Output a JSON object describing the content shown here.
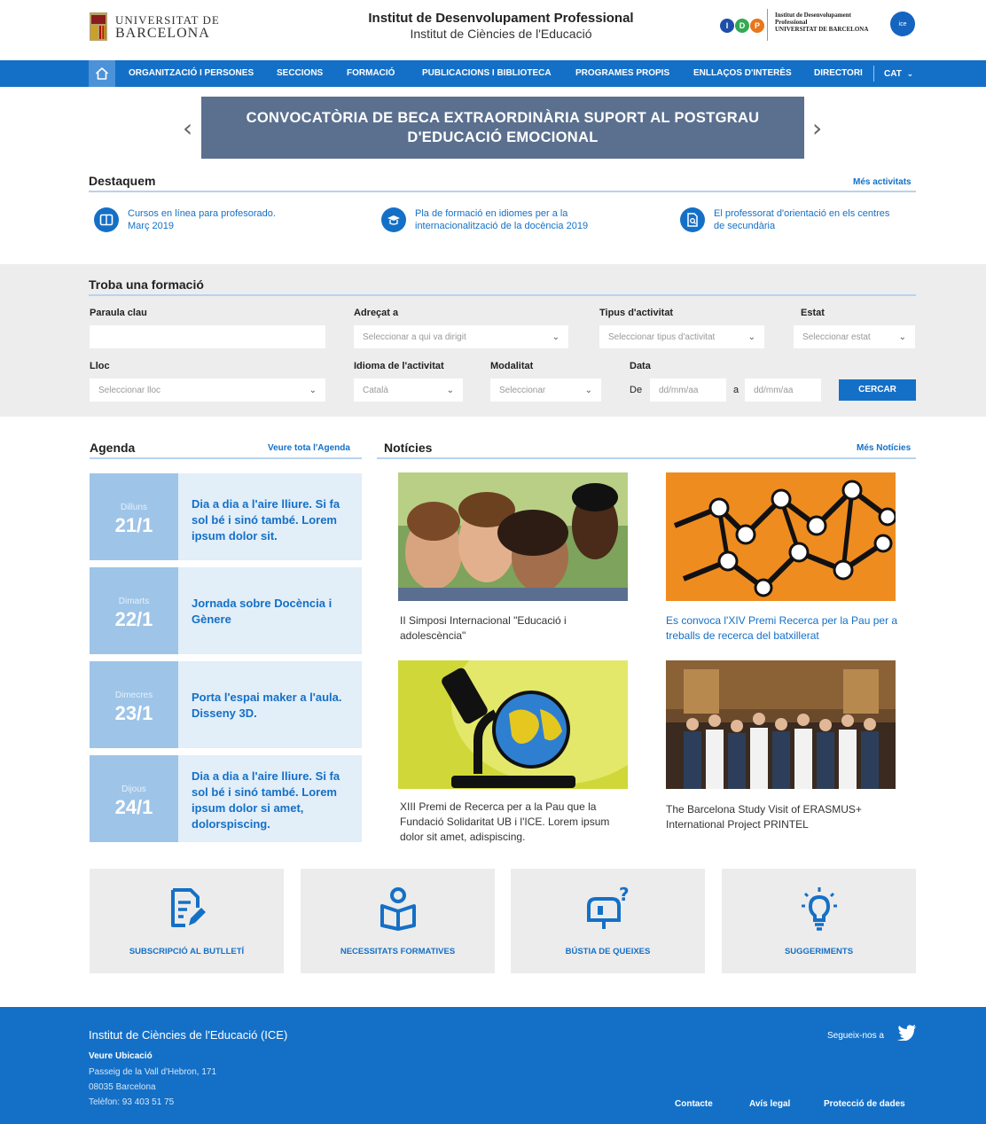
{
  "header": {
    "ub_line1": "UNIVERSITAT DE",
    "ub_line2": "BARCELONA",
    "title": "Institut de Desenvolupament Professional",
    "subtitle": "Institut de Ciències de l'Educació",
    "idp_text_1": "Institut de Desenvolupament",
    "idp_text_2": "Professional",
    "idp_text_3": "UNIVERSITAT DE BARCELONA",
    "ice_badge": "ice"
  },
  "nav": {
    "items": [
      "ORGANITZACIÓ I PERSONES",
      "SECCIONS",
      "FORMACIÓ",
      "PUBLICACIONS I BIBLIOTECA",
      "PROGRAMES PROPIS",
      "ENLLAÇOS D'INTERÈS",
      "DIRECTORI"
    ],
    "lang": "CAT"
  },
  "banner": {
    "line1": "CONVOCATÒRIA DE BECA EXTRAORDINÀRIA SUPORT AL POSTGRAU",
    "line2": "D'EDUCACIÓ EMOCIONAL"
  },
  "destaquem": {
    "title": "Destaquem",
    "more": "Més activitats",
    "items": [
      {
        "l1": "Cursos en línea para profesorado.",
        "l2": "Març 2019"
      },
      {
        "l1": "Pla de formació en idiomes per a la",
        "l2": "internacionalització de la docència 2019"
      },
      {
        "l1": "El professorat d'orientació en els centres",
        "l2": "de secundària"
      }
    ]
  },
  "search": {
    "title": "Troba una formació",
    "keyword_label": "Paraula clau",
    "adrecat_label": "Adreçat a",
    "adrecat_ph": "Seleccionar a qui va dirigit",
    "tipus_label": "Tipus d'activitat",
    "tipus_ph": "Seleccionar tipus d'activitat",
    "estat_label": "Estat",
    "estat_ph": "Seleccionar estat",
    "lloc_label": "Lloc",
    "lloc_ph": "Seleccionar lloc",
    "idioma_label": "Idioma de l'activitat",
    "idioma_value": "Català",
    "modalitat_label": "Modalitat",
    "modalitat_ph": "Seleccionar",
    "data_label": "Data",
    "de": "De",
    "date_from_ph": "dd/mm/aa",
    "a": "a",
    "date_to_ph": "dd/mm/aa",
    "button": "CERCAR"
  },
  "agenda": {
    "title": "Agenda",
    "more": "Veure tota l'Agenda",
    "items": [
      {
        "day": "Dilluns",
        "date": "21/1",
        "title": "Dia a dia a l'aire lliure. Si fa sol bé i sinó també. Lorem ipsum dolor sit."
      },
      {
        "day": "Dimarts",
        "date": "22/1",
        "title": "Jornada sobre Docència i Gènere"
      },
      {
        "day": "Dimecres",
        "date": "23/1",
        "title": "Porta l'espai maker a l'aula. Disseny 3D."
      },
      {
        "day": "Dijous",
        "date": "24/1",
        "title": "Dia a dia a l'aire lliure. Si fa sol bé i sinó també. Lorem ipsum dolor si amet, dolorspiscing."
      }
    ]
  },
  "news": {
    "title": "Notícies",
    "more": "Més Notícies",
    "items": [
      {
        "caption": "II Simposi Internacional \"Educació i adolescència\""
      },
      {
        "caption": "Es convoca l'XIV Premi Recerca per la Pau per a treballs de recerca del batxillerat"
      },
      {
        "caption": "XIII Premi de Recerca per a la Pau que la Fundació Solidaritat UB i l'ICE. Lorem ipsum dolor sit amet, adispiscing."
      },
      {
        "caption": "The Barcelona Study Visit of ERASMUS+ International Project PRINTEL"
      }
    ]
  },
  "tiles": [
    {
      "label": "SUBSCRIPCIÓ AL BUTLLETÍ",
      "icon": "document-edit-icon"
    },
    {
      "label": "NECESSITATS FORMATIVES",
      "icon": "reader-book-icon"
    },
    {
      "label": "BÚSTIA DE QUEIXES",
      "icon": "mailbox-question-icon"
    },
    {
      "label": "SUGGERIMENTS",
      "icon": "lightbulb-icon"
    }
  ],
  "footer": {
    "title": "Institut de Ciències de l'Educació (ICE)",
    "location_link": "Veure Ubicació",
    "address1": "Passeig de la Vall d'Hebron, 171",
    "address2": "08035 Barcelona",
    "phone": "Telèfon: 93 403 51 75",
    "follow": "Segueix-nos a",
    "links": [
      "Contacte",
      "Avís legal",
      "Protecció de dades"
    ]
  },
  "colors": {
    "primary": "#1470c7",
    "banner": "#5b708f",
    "agenda_date": "#9ec4e8",
    "agenda_bg": "#e2eef8"
  }
}
